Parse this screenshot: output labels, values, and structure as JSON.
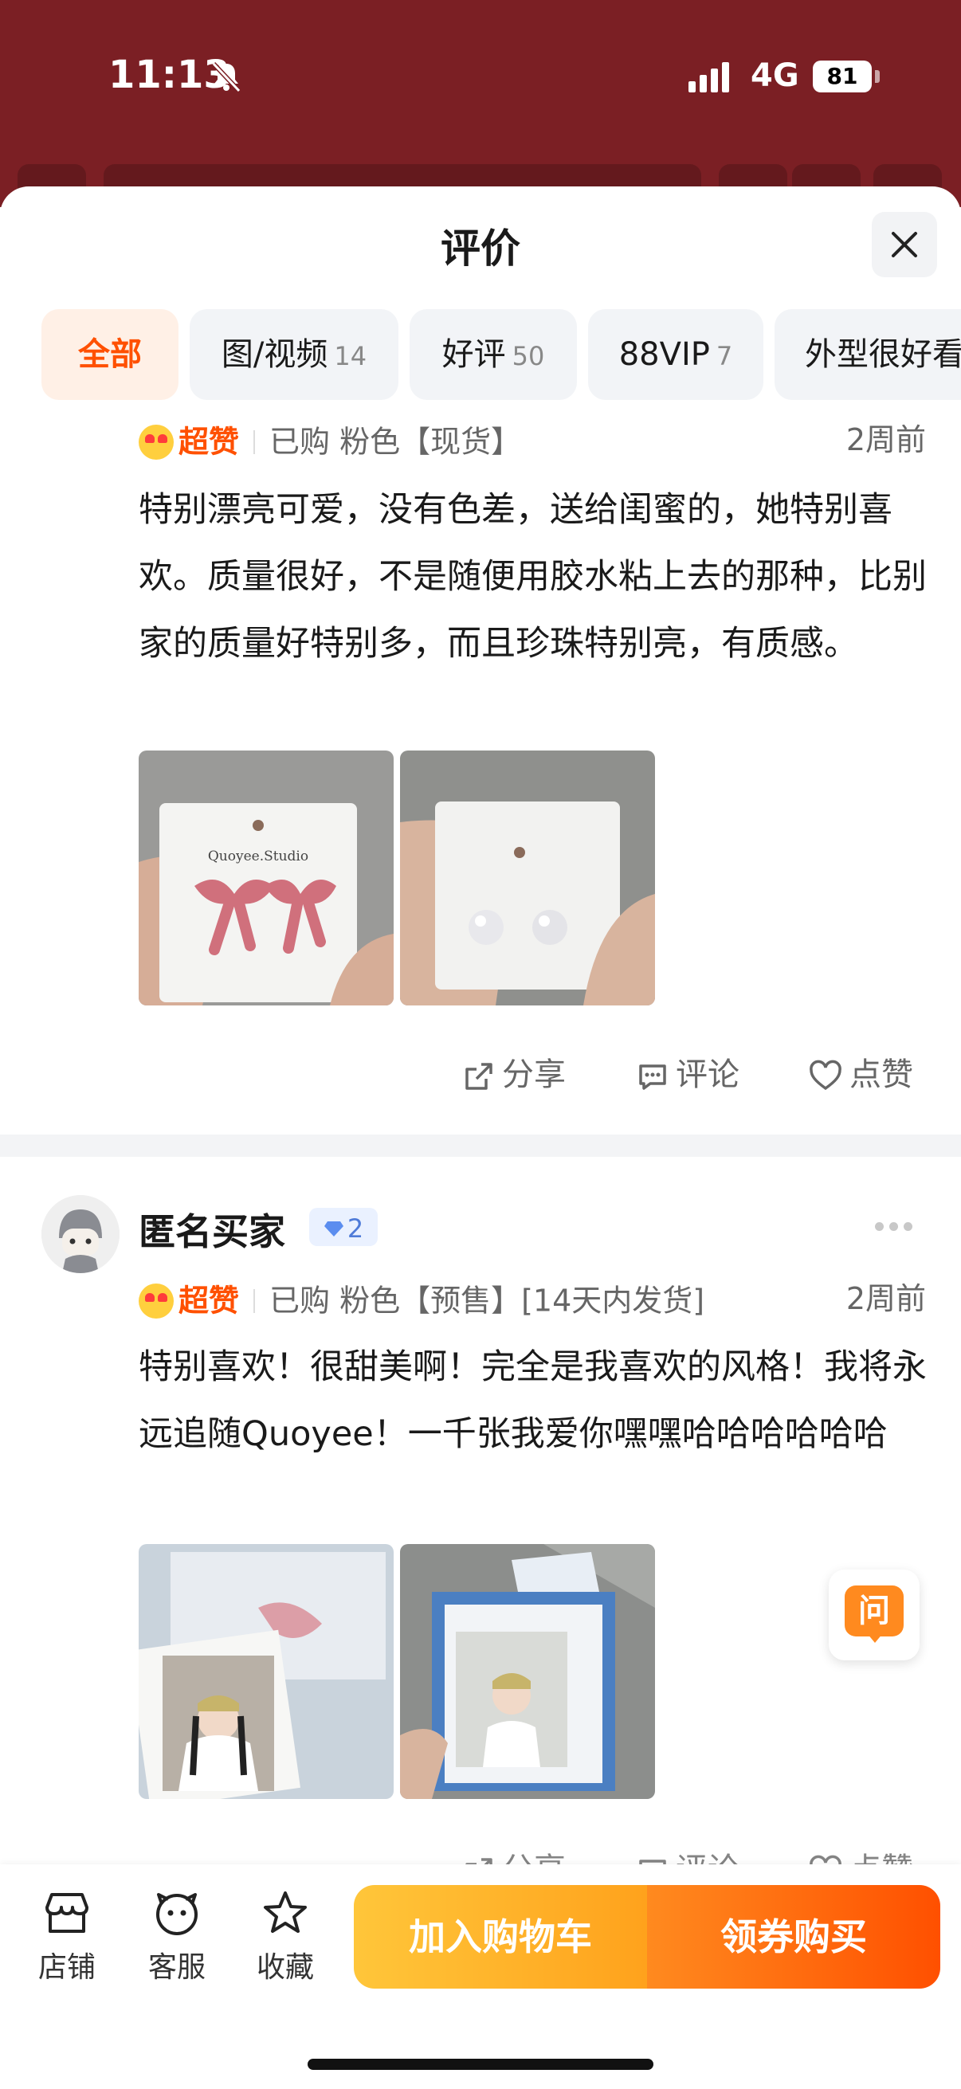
{
  "status_bar": {
    "time": "11:13",
    "network": "4G",
    "battery": "81"
  },
  "sheet": {
    "title": "评价"
  },
  "tabs": [
    {
      "label": "全部",
      "count": ""
    },
    {
      "label": "图/视频",
      "count": "14"
    },
    {
      "label": "好评",
      "count": "50"
    },
    {
      "label": "88VIP",
      "count": "7"
    },
    {
      "label": "外型很好看",
      "count": ""
    }
  ],
  "reviews": [
    {
      "rating": "超赞",
      "purchase": "已购 粉色【现货】",
      "time": "2周前",
      "text": "特别漂亮可爱，没有色差，送给闺蜜的，她特别喜欢。质量很好，不是随便用胶水粘上去的那种，比别家的质量好特别多，而且珍珠特别亮，有质感。",
      "photo1_brand": "Quoyee.Studio",
      "share": "分享",
      "comment": "评论",
      "like": "点赞"
    },
    {
      "user": "匿名买家",
      "level": "2",
      "rating": "超赞",
      "purchase": "已购 粉色【预售】[14天内发货]",
      "time": "2周前",
      "text": "特别喜欢！很甜美啊！完全是我喜欢的风格！我将永远追随Quoyee！一千张我爱你嘿嘿哈哈哈哈哈哈",
      "share": "分享",
      "comment": "评论",
      "like": "点赞"
    }
  ],
  "ask_label": "问",
  "bottom_nav": [
    {
      "label": "店铺",
      "icon": "store-icon"
    },
    {
      "label": "客服",
      "icon": "service-icon"
    },
    {
      "label": "收藏",
      "icon": "star-icon"
    }
  ],
  "buttons": {
    "cart": "加入购物车",
    "buy": "领券购买"
  },
  "colors": {
    "accent": "#ff5000",
    "header_bg": "#7b1f24",
    "cart": "#ffb22e",
    "buy": "#ff6a14"
  }
}
